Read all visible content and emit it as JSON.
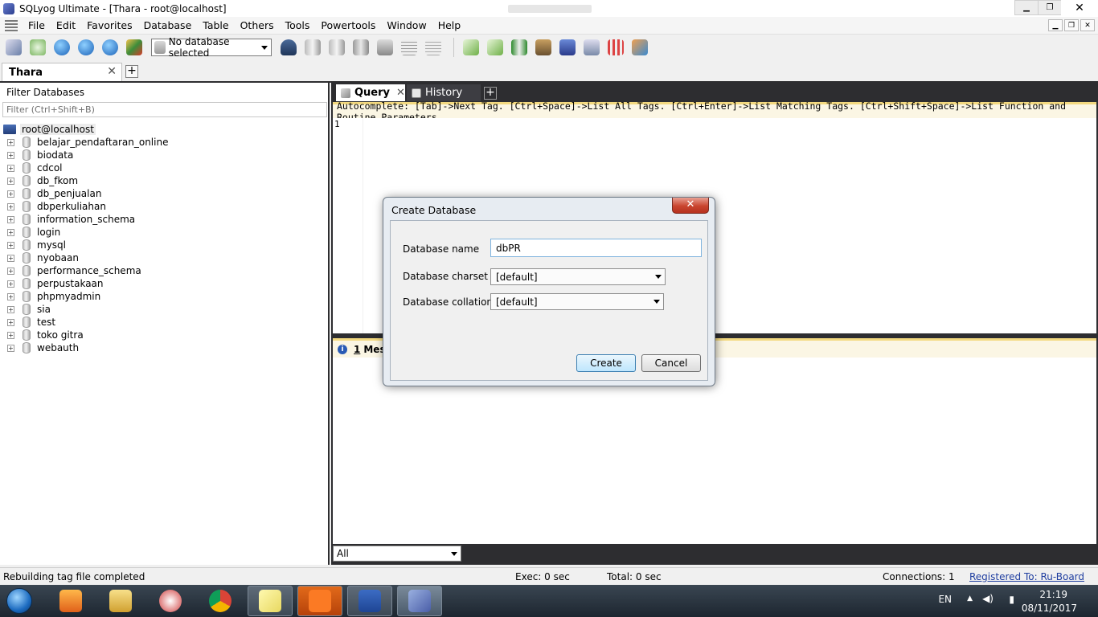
{
  "window": {
    "title": "SQLyog Ultimate - [Thara - root@localhost]",
    "min": "▁",
    "max": "❐",
    "close": "✕"
  },
  "menu": [
    "File",
    "Edit",
    "Favorites",
    "Database",
    "Table",
    "Others",
    "Tools",
    "Powertools",
    "Window",
    "Help"
  ],
  "mdi_buttons": [
    "▁",
    "❐",
    "✕"
  ],
  "toolbar": {
    "db_selector": "No database selected"
  },
  "connection_tab": {
    "label": "Thara",
    "close": "✕",
    "add": "+"
  },
  "left_panel": {
    "filter_label": "Filter Databases",
    "filter_placeholder": "Filter (Ctrl+Shift+B)",
    "root": "root@localhost",
    "databases": [
      "belajar_pendaftaran_online",
      "biodata",
      "cdcol",
      "db_fkom",
      "db_penjualan",
      "dbperkuliahan",
      "information_schema",
      "login",
      "mysql",
      "nyobaan",
      "performance_schema",
      "perpustakaan",
      "phpmyadmin",
      "sia",
      "test",
      "toko gitra",
      "webauth"
    ]
  },
  "query_tabs": {
    "query": "Query",
    "history": "History",
    "close": "✕",
    "add": "+"
  },
  "autocomplete_hint": "Autocomplete: [Tab]->Next Tag. [Ctrl+Space]->List All Tags. [Ctrl+Enter]->List Matching Tags. [Ctrl+Shift+Space]->List Function and Routine Parameters.",
  "editor": {
    "line_number": "1"
  },
  "messages": {
    "count": "1",
    "label": "Mes"
  },
  "result_filter": "All",
  "status": {
    "message": "Rebuilding tag file completed",
    "exec": "Exec: 0 sec",
    "total": "Total: 0 sec",
    "connections": "Connections: 1",
    "registered": "Registered To: Ru-Board"
  },
  "dialog": {
    "title": "Create Database",
    "close": "✕",
    "db_name_label": "Database name",
    "db_name_value": "dbPR",
    "charset_label": "Database charset",
    "charset_value": "[default]",
    "collation_label": "Database collation",
    "collation_value": "[default]",
    "create": "Create",
    "cancel": "Cancel"
  },
  "tray": {
    "lang": "EN",
    "time": "21:19",
    "date": "08/11/2017"
  },
  "colors": {
    "dark_panel": "#2d2d30",
    "hint_bar": "#fbf6e4",
    "accent_blue": "#1c6bc0"
  },
  "icons": [
    "database-refresh-icon",
    "new-connection-icon",
    "execute-icon",
    "execute-all-icon",
    "user-manager-icon",
    "schema-designer-icon",
    "query-builder-icon",
    "backup-icon",
    "restore-icon",
    "import-icon",
    "export-icon",
    "sync-icon",
    "notifications-icon",
    "scheduler-icon"
  ]
}
